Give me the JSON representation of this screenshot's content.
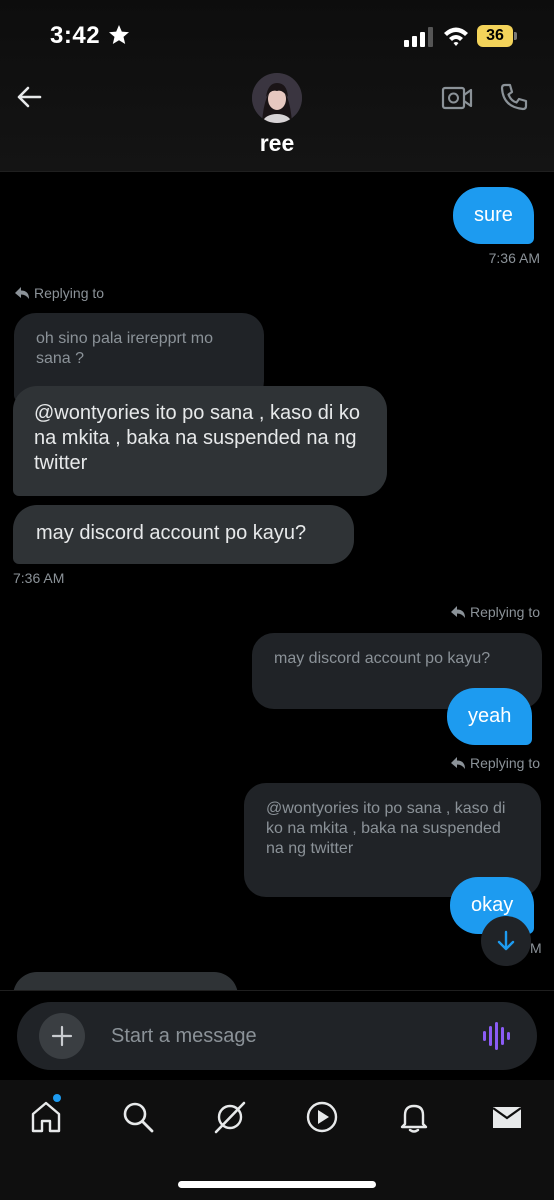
{
  "status_bar": {
    "time": "3:42",
    "battery": "36"
  },
  "header": {
    "contact_name": "ree"
  },
  "messages": [
    {
      "text": "sure",
      "time": "7:36 AM"
    },
    {
      "reply_label": "Replying to",
      "quote": "oh sino pala irerepprt mo sana ?"
    },
    {
      "text": "@wontyories ito po sana , kaso di ko na mkita , baka na suspended na ng twitter"
    },
    {
      "text": "may discord account po kayu?",
      "time": "7:36 AM"
    },
    {
      "reply_label": "Replying to",
      "quote": "may discord account po kayu?",
      "text": "yeah"
    },
    {
      "reply_label": "Replying to",
      "quote": "@wontyories ito po sana , kaso di ko na mkita , baka na suspended na ng twitter",
      "text": "okay",
      "time_partial": "M"
    }
  ],
  "composer": {
    "placeholder": "Start a message"
  },
  "colors": {
    "accent": "#1d9bf0",
    "voice": "#8b5cf6",
    "battery": "#f3d35a"
  },
  "icons": [
    "back-arrow-icon",
    "video-icon",
    "phone-icon",
    "reply-arrow-icon",
    "plus-icon",
    "voice-wave-icon",
    "home-icon",
    "search-icon",
    "grok-icon",
    "video-play-icon",
    "bell-icon",
    "mail-icon"
  ]
}
